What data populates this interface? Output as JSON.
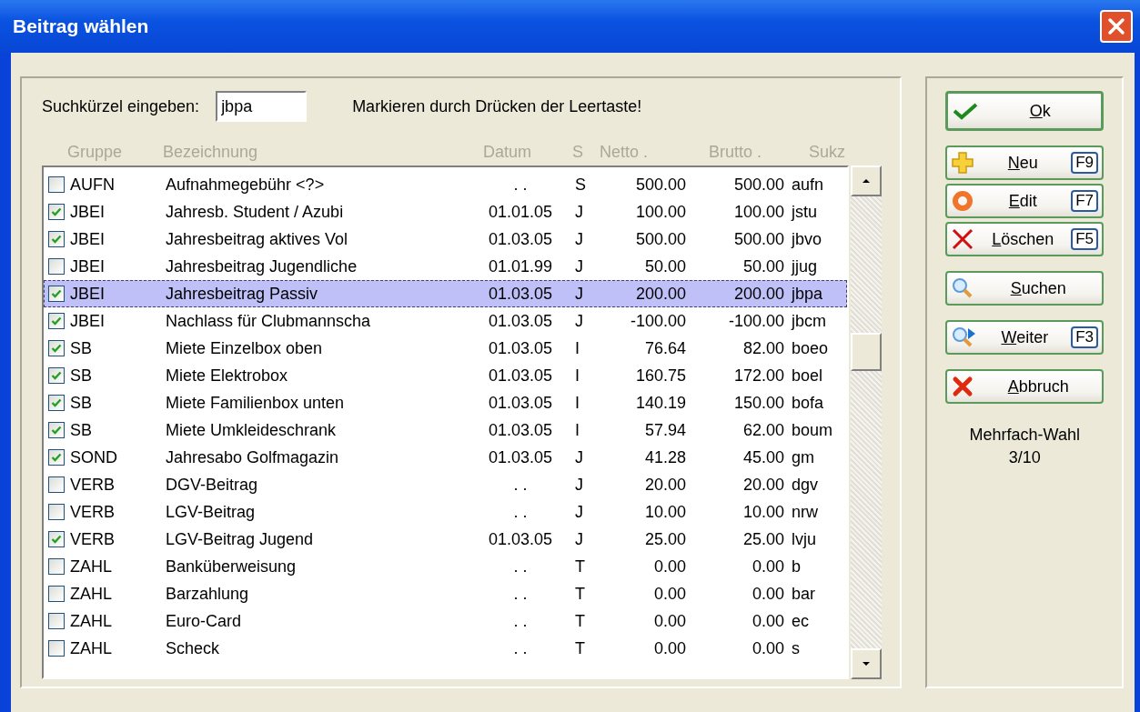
{
  "window": {
    "title": "Beitrag wählen"
  },
  "search": {
    "label": "Suchkürzel eingeben:",
    "value": "jbpa",
    "hint": "Markieren durch Drücken der Leertaste!"
  },
  "table": {
    "columns": [
      "Gruppe",
      "Bezeichnung",
      "Datum",
      "S",
      "Netto .",
      "Brutto .",
      "Sukz"
    ],
    "rows": [
      {
        "checked": false,
        "selected": false,
        "cells": [
          "AUFN",
          "Aufnahmegebühr <?>",
          ". .",
          "S",
          "500.00",
          "500.00",
          "aufn"
        ]
      },
      {
        "checked": true,
        "selected": false,
        "cells": [
          "JBEI",
          "Jahresb. Student / Azubi",
          "01.01.05",
          "J",
          "100.00",
          "100.00",
          "jstu"
        ]
      },
      {
        "checked": true,
        "selected": false,
        "cells": [
          "JBEI",
          "Jahresbeitrag aktives Vol",
          "01.03.05",
          "J",
          "500.00",
          "500.00",
          "jbvo"
        ]
      },
      {
        "checked": false,
        "selected": false,
        "cells": [
          "JBEI",
          "Jahresbeitrag Jugendliche",
          "01.01.99",
          "J",
          "50.00",
          "50.00",
          "jjug"
        ]
      },
      {
        "checked": true,
        "selected": true,
        "cells": [
          "JBEI",
          "Jahresbeitrag Passiv",
          "01.03.05",
          "J",
          "200.00",
          "200.00",
          "jbpa"
        ]
      },
      {
        "checked": true,
        "selected": false,
        "cells": [
          "JBEI",
          "Nachlass für Clubmannscha",
          "01.03.05",
          "J",
          "-100.00",
          "-100.00",
          "jbcm"
        ]
      },
      {
        "checked": true,
        "selected": false,
        "cells": [
          "SB",
          "Miete Einzelbox oben",
          "01.03.05",
          "I",
          "76.64",
          "82.00",
          "boeo"
        ]
      },
      {
        "checked": true,
        "selected": false,
        "cells": [
          "SB",
          "Miete Elektrobox",
          "01.03.05",
          "I",
          "160.75",
          "172.00",
          "boel"
        ]
      },
      {
        "checked": true,
        "selected": false,
        "cells": [
          "SB",
          "Miete Familienbox unten",
          "01.03.05",
          "I",
          "140.19",
          "150.00",
          "bofa"
        ]
      },
      {
        "checked": true,
        "selected": false,
        "cells": [
          "SB",
          "Miete Umkleideschrank",
          "01.03.05",
          "I",
          "57.94",
          "62.00",
          "boum"
        ]
      },
      {
        "checked": true,
        "selected": false,
        "cells": [
          "SOND",
          "Jahresabo Golfmagazin",
          "01.03.05",
          "J",
          "41.28",
          "45.00",
          "gm"
        ]
      },
      {
        "checked": false,
        "selected": false,
        "cells": [
          "VERB",
          "DGV-Beitrag",
          ". .",
          "J",
          "20.00",
          "20.00",
          "dgv"
        ]
      },
      {
        "checked": false,
        "selected": false,
        "cells": [
          "VERB",
          "LGV-Beitrag",
          ". .",
          "J",
          "10.00",
          "10.00",
          "nrw"
        ]
      },
      {
        "checked": true,
        "selected": false,
        "cells": [
          "VERB",
          "LGV-Beitrag Jugend",
          "01.03.05",
          "J",
          "25.00",
          "25.00",
          "lvju"
        ]
      },
      {
        "checked": false,
        "selected": false,
        "cells": [
          "ZAHL",
          "Banküberweisung",
          ". .",
          "T",
          "0.00",
          "0.00",
          "b"
        ]
      },
      {
        "checked": false,
        "selected": false,
        "cells": [
          "ZAHL",
          "Barzahlung",
          ". .",
          "T",
          "0.00",
          "0.00",
          "bar"
        ]
      },
      {
        "checked": false,
        "selected": false,
        "cells": [
          "ZAHL",
          "Euro-Card",
          ". .",
          "T",
          "0.00",
          "0.00",
          "ec"
        ]
      },
      {
        "checked": false,
        "selected": false,
        "cells": [
          "ZAHL",
          "Scheck",
          ". .",
          "T",
          "0.00",
          "0.00",
          "s"
        ]
      }
    ]
  },
  "buttons": [
    {
      "label": "Ok"
    },
    {
      "label": "Neu",
      "key": "F9"
    },
    {
      "label": "Edit",
      "key": "F7"
    },
    {
      "label": "Löschen",
      "key": "F5"
    },
    {
      "label": "Suchen"
    },
    {
      "label": "Weiter",
      "key": "F3"
    },
    {
      "label": "Abbruch"
    }
  ],
  "status": {
    "label": "Mehrfach-Wahl",
    "count": "3/10"
  }
}
